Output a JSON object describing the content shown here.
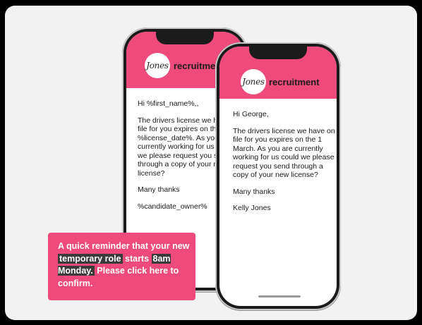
{
  "back_phone": {
    "brand_script": "Jones",
    "brand_name": "recruitment",
    "greeting": "Hi %first_name%,,",
    "body": "The drivers license we have on file for you expires on the %license_date%. As you are currently working for us could we please request you send through a copy of your new license?",
    "closing": "Many thanks",
    "signature": "%candidate_owner%"
  },
  "front_phone": {
    "brand_script": "Jones",
    "brand_name": "recruitment",
    "greeting": "Hi George,",
    "body": "The drivers license we have on file for you expires on the 1 March. As you are currently working for us could we please request you send through a copy of your new license?",
    "closing": "Many thanks",
    "signature": "Kelly Jones"
  },
  "callout": {
    "part1": "A quick reminder that your new ",
    "highlight1": "temporary role",
    "part2": " starts ",
    "highlight2": "8am Monday.",
    "part3": " Please click here to confirm."
  },
  "colors": {
    "brand_pink": "#ee4a7c",
    "highlight_bg": "#3a3a3a"
  }
}
